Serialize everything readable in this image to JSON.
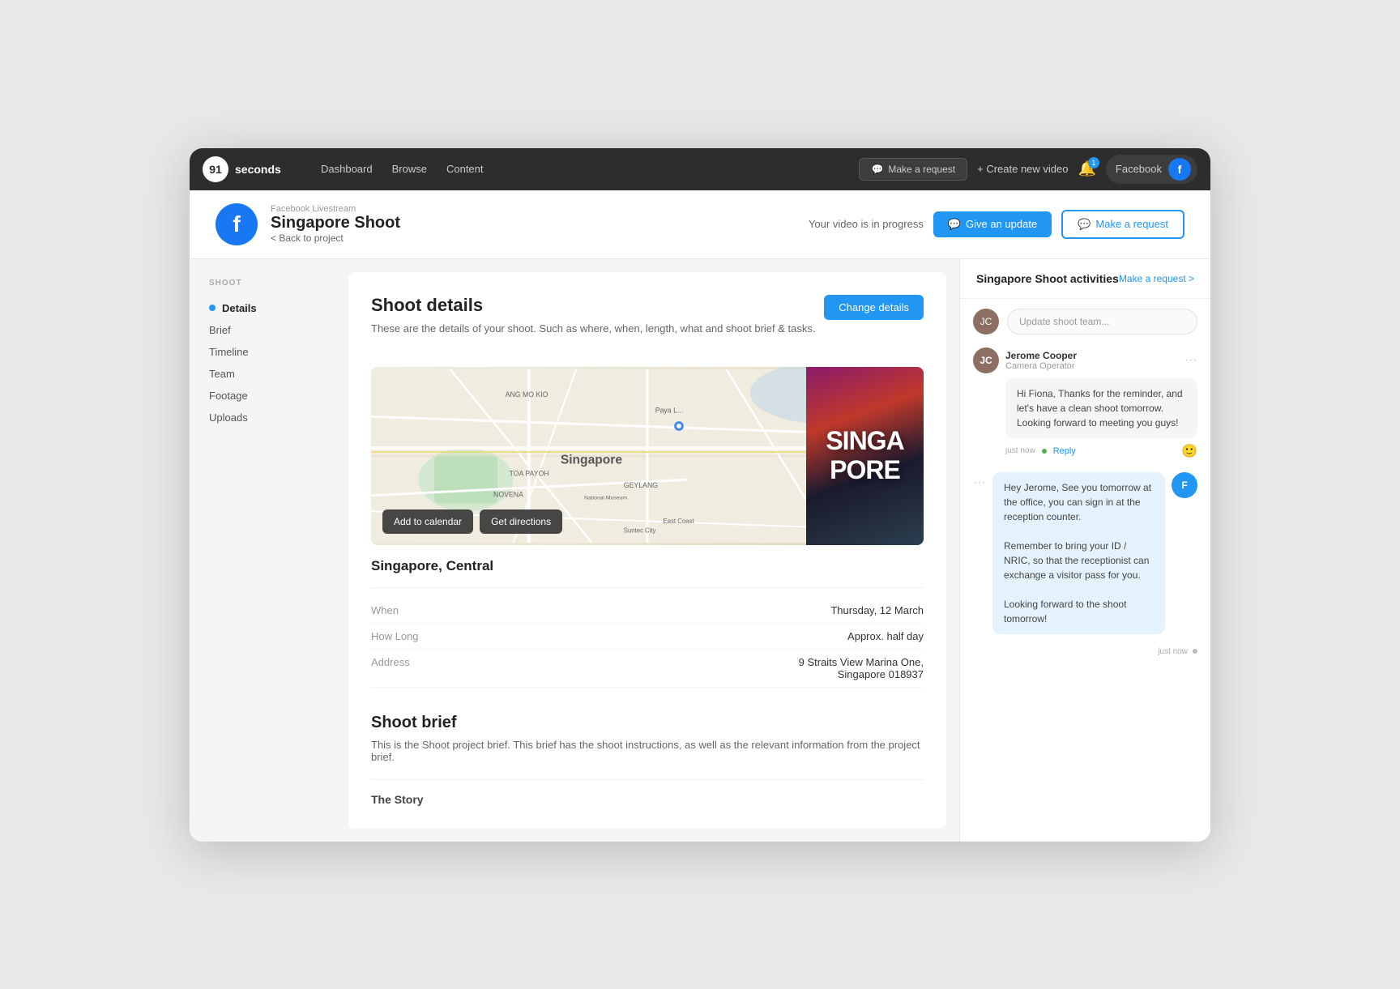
{
  "topbar": {
    "logo_number": "91",
    "logo_text": "seconds",
    "nav": [
      {
        "label": "Dashboard",
        "id": "dashboard"
      },
      {
        "label": "Browse",
        "id": "browse"
      },
      {
        "label": "Content",
        "id": "content"
      }
    ],
    "make_request_label": "Make a request",
    "create_video_label": "+ Create new video",
    "bell_badge": "1",
    "user_label": "Facebook",
    "user_initial": "f"
  },
  "project_header": {
    "project_type": "Facebook Livestream",
    "project_title": "Singapore Shoot",
    "back_label": "< Back to project",
    "status_text": "Your video is in progress",
    "give_update_label": "Give an update",
    "make_request_label": "Make a request"
  },
  "sidebar": {
    "section_label": "SHOOT",
    "items": [
      {
        "label": "Details",
        "active": true,
        "id": "details"
      },
      {
        "label": "Brief",
        "active": false,
        "id": "brief"
      },
      {
        "label": "Timeline",
        "active": false,
        "id": "timeline"
      },
      {
        "label": "Team",
        "active": false,
        "id": "team"
      },
      {
        "label": "Footage",
        "active": false,
        "id": "footage"
      },
      {
        "label": "Uploads",
        "active": false,
        "id": "uploads"
      }
    ]
  },
  "shoot_details": {
    "title": "Shoot details",
    "description": "These are the details of your shoot. Such as where, when, length, what and shoot brief & tasks.",
    "change_details_label": "Change details",
    "map_label": "Singapore",
    "singapore_image_text": "SINGA\nPORE",
    "add_calendar_label": "Add to calendar",
    "get_directions_label": "Get directions",
    "location_name": "Singapore, Central",
    "details": [
      {
        "label": "When",
        "value": "Thursday, 12 March"
      },
      {
        "label": "How Long",
        "value": "Approx. half day"
      },
      {
        "label": "Address",
        "value": "9 Straits View Marina One,\nSingapore 018937"
      }
    ]
  },
  "shoot_brief": {
    "title": "Shoot brief",
    "description": "This is the Shoot project brief. This brief has the shoot instructions, as well as the relevant information from the project brief.",
    "story_label": "The Story"
  },
  "activities": {
    "title": "Singapore Shoot activities",
    "make_request_label": "Make a request >",
    "comment_placeholder": "Update shoot team...",
    "messages": [
      {
        "id": "jerome",
        "sender": "Jerome Cooper",
        "role": "Camera Operator",
        "avatar_bg": "#8d6e63",
        "avatar_initial": "JC",
        "text": "Hi Fiona,  Thanks for the reminder, and let's have a clean shoot tomorrow.  Looking forward to meeting you guys!",
        "timestamp": "just now",
        "online": true,
        "type": "incoming"
      },
      {
        "id": "outgoing",
        "type": "outgoing",
        "text": "Hey Jerome,  See you tomorrow at the office, you can sign in at the reception counter.\n\nRemember to bring your ID / NRIC, so that the receptionist can exchange a visitor pass for you.\n\nLooking forward to the shoot tomorrow!",
        "timestamp": "just now",
        "avatar_bg": "#2196f3",
        "avatar_initial": "F"
      }
    ]
  }
}
